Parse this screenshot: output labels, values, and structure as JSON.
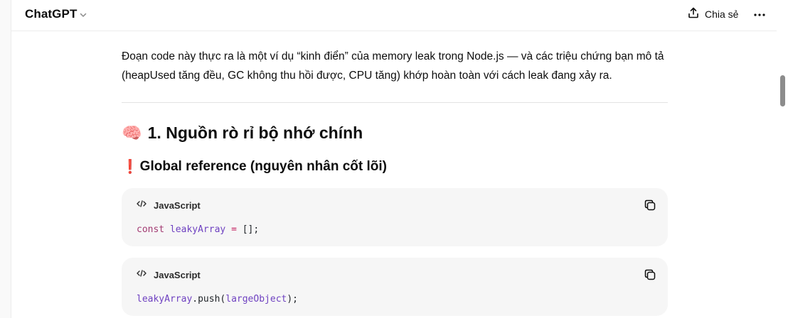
{
  "header": {
    "model_name": "ChatGPT",
    "share_label": "Chia sẻ"
  },
  "message": {
    "paragraph": "Đoạn code này thực ra là một ví dụ “kinh điển” của memory leak trong Node.js — và các triệu chứng bạn mô tả (heapUsed tăng đều, GC không thu hồi được, CPU tăng) khớp hoàn toàn với cách leak đang xảy ra.",
    "heading_emoji": "🧠",
    "heading": "1. Nguồn rò rỉ bộ nhớ chính",
    "subheading_emoji": "❗",
    "subheading": "Global reference (nguyên nhân cốt lõi)"
  },
  "code_blocks": [
    {
      "language": "JavaScript",
      "tokens": {
        "kw": "const",
        "var": "leakyArray",
        "op": "=",
        "rest": "[];"
      }
    },
    {
      "language": "JavaScript",
      "tokens": {
        "var": "leakyArray",
        "dot": ".push(",
        "arg": "largeObject",
        "rest": ");"
      }
    }
  ],
  "icons": {
    "chevron": "chevron-down-icon",
    "share": "share-upload-icon",
    "more": "more-horizontal-icon",
    "code": "code-icon",
    "copy": "copy-icon"
  },
  "colors": {
    "code_background": "#f6f6f6",
    "keyword": "#a23b72",
    "variable": "#6f42c1"
  }
}
